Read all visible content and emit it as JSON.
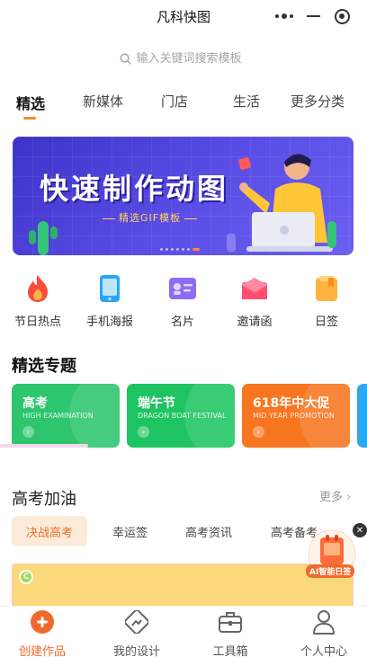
{
  "app": {
    "title": "凡科快图"
  },
  "search": {
    "placeholder": "输入关键词搜索模板"
  },
  "tabs": [
    {
      "label": "精选",
      "active": true
    },
    {
      "label": "新媒体"
    },
    {
      "label": "门店"
    },
    {
      "label": "生活"
    },
    {
      "label": "更多分类"
    }
  ],
  "banner": {
    "headline": "快速制作动图",
    "subline": "精选GIF模板",
    "slide_count": 7,
    "current_slide": 7
  },
  "quick_actions": [
    {
      "label": "节日热点",
      "icon": "fire-icon"
    },
    {
      "label": "手机海报",
      "icon": "phone-icon"
    },
    {
      "label": "名片",
      "icon": "card-icon"
    },
    {
      "label": "邀请函",
      "icon": "envelope-icon"
    },
    {
      "label": "日签",
      "icon": "calendar-icon"
    }
  ],
  "featured": {
    "title": "精选专题",
    "cards": [
      {
        "title": "高考",
        "subtitle": "HIGH  EXAMINATION",
        "color": "#2dc56e"
      },
      {
        "title": "端午节",
        "subtitle": "DRAGON BOAT FESTIVAL",
        "color": "#1fc462"
      },
      {
        "title": "618年中大促",
        "subtitle": "MID YEAR PROMOTION",
        "color": "#f7761f"
      },
      {
        "title": "",
        "subtitle": "",
        "color": "#2aa9f0"
      }
    ]
  },
  "section2": {
    "title": "高考加油",
    "more": "更多",
    "subtabs": [
      {
        "label": "决战高考",
        "active": true
      },
      {
        "label": "幸运签"
      },
      {
        "label": "高考资讯"
      },
      {
        "label": "高考备考"
      }
    ],
    "preview_badge": "C"
  },
  "ai_widget": {
    "label": "AI智能日签"
  },
  "bottom_nav": [
    {
      "label": "创建作品",
      "icon": "plus-circle-icon",
      "active": true
    },
    {
      "label": "我的设计",
      "icon": "image-icon"
    },
    {
      "label": "工具箱",
      "icon": "toolbox-icon"
    },
    {
      "label": "个人中心",
      "icon": "user-icon"
    }
  ],
  "colors": {
    "accent": "#f06a2e",
    "banner": "#4b3fd8"
  }
}
